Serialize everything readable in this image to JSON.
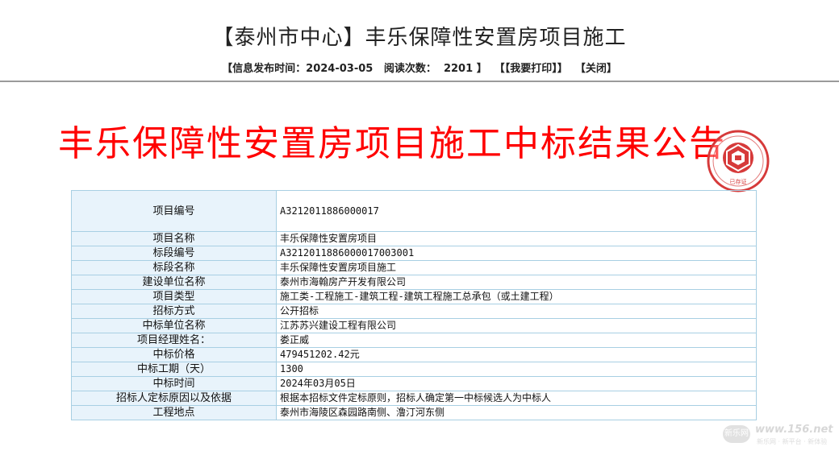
{
  "header": {
    "title": "【泰州市中心】丰乐保障性安置房项目施工",
    "meta": {
      "publish_label": "【信息发布时间：",
      "publish_date": "2024-03-05",
      "views_label": "阅读次数：",
      "views_count": "2201",
      "views_close": "】",
      "print_link": "【【我要打印】】",
      "close_link": "【关闭】"
    }
  },
  "notice": {
    "title": "丰乐保障性安置房项目施工中标结果公告",
    "stamp_text": "已存证"
  },
  "table": {
    "rows": [
      {
        "label": "项目编号",
        "value": "A3212011886000017"
      },
      {
        "label": "项目名称",
        "value": "丰乐保障性安置房项目"
      },
      {
        "label": "标段编号",
        "value": "A3212011886000017003001"
      },
      {
        "label": "标段名称",
        "value": "丰乐保障性安置房项目施工"
      },
      {
        "label": "建设单位名称",
        "value": "泰州市海翰房产开发有限公司"
      },
      {
        "label": "项目类型",
        "value": "施工类-工程施工-建筑工程-建筑工程施工总承包（或土建工程）"
      },
      {
        "label": "招标方式",
        "value": "公开招标"
      },
      {
        "label": "中标单位名称",
        "value": "江苏苏兴建设工程有限公司"
      },
      {
        "label": "项目经理姓名：",
        "value": "娄正威"
      },
      {
        "label": "中标价格",
        "value": "479451202.42元"
      },
      {
        "label": "中标工期（天）",
        "value": "1300"
      },
      {
        "label": "中标时间",
        "value": "2024年03月05日"
      },
      {
        "label": "招标人定标原因以及依据",
        "value": "根据本招标文件定标原则，招标人确定第一中标候选人为中标人"
      },
      {
        "label": "工程地点",
        "value": "泰州市海陵区森园路南侧、澛汀河东侧"
      }
    ]
  },
  "watermark": {
    "badge": "新乐网",
    "site": "www.156.net",
    "slogan": "新乐网 · 新平台 · 新体验"
  },
  "colors": {
    "title_red": "#ff0000",
    "table_border": "#a8cfe3",
    "label_bg": "#e8f3fb",
    "stamp_red": "#d63a3a"
  }
}
